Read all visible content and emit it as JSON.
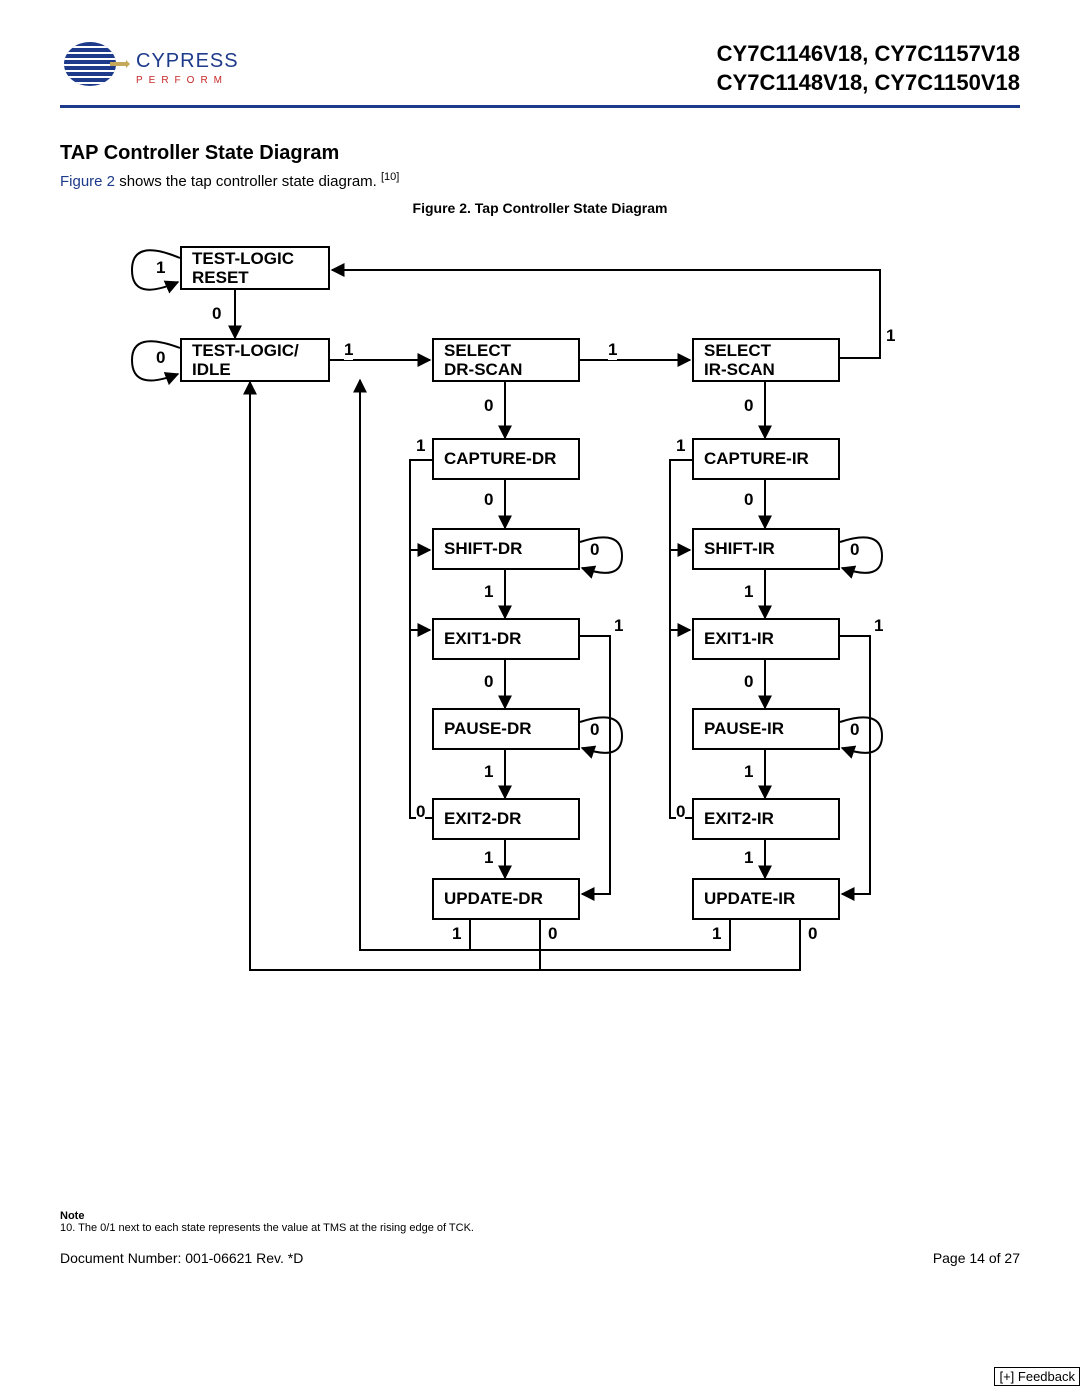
{
  "header": {
    "logo_name": "CYPRESS",
    "logo_tagline": "PERFORM",
    "parts_line1": "CY7C1146V18, CY7C1157V18",
    "parts_line2": "CY7C1148V18, CY7C1150V18"
  },
  "section_title": "TAP Controller State Diagram",
  "intro_prefix": "Figure 2",
  "intro_rest": " shows the tap controller state diagram. ",
  "intro_foot": "[10]",
  "figure_caption": "Figure 2. Tap Controller State Diagram",
  "states": {
    "tlr": "TEST-LOGIC\nRESET",
    "rti": "TEST-LOGIC/\nIDLE",
    "sel_dr": "SELECT\nDR-SCAN",
    "sel_ir": "SELECT\nIR-SCAN",
    "cap_dr": "CAPTURE-DR",
    "cap_ir": "CAPTURE-IR",
    "shift_dr": "SHIFT-DR",
    "shift_ir": "SHIFT-IR",
    "exit1_dr": "EXIT1-DR",
    "exit1_ir": "EXIT1-IR",
    "pause_dr": "PAUSE-DR",
    "pause_ir": "PAUSE-IR",
    "exit2_dr": "EXIT2-DR",
    "exit2_ir": "EXIT2-IR",
    "update_dr": "UPDATE-DR",
    "update_ir": "UPDATE-IR"
  },
  "edge_labels": {
    "tlr_self": "1",
    "tlr_to_rti": "0",
    "rti_self": "0",
    "rti_to_seldr": "1",
    "seldr_to_selir": "1",
    "selir_to_tlr": "1",
    "seldr_to_capdr": "0",
    "selir_to_capir": "0",
    "capdr_to_exit1dr": "1",
    "capir_to_exit1ir": "1",
    "capdr_to_shiftdr": "0",
    "capir_to_shiftir": "0",
    "shiftdr_self": "0",
    "shiftir_self": "0",
    "shiftdr_to_exit1dr": "1",
    "shiftir_to_exit1ir": "1",
    "exit1dr_to_updatedr": "1",
    "exit1ir_to_updateir": "1",
    "exit1dr_to_pausedr": "0",
    "exit1ir_to_pauseir": "0",
    "pausedr_self": "0",
    "pauseir_self": "0",
    "pausedr_to_exit2dr": "1",
    "pauseir_to_exit2ir": "1",
    "exit2dr_to_shiftdr": "0",
    "exit2ir_to_shiftir": "0",
    "exit2dr_to_updatedr": "1",
    "exit2ir_to_updateir": "1",
    "updatedr_to_seldr_1": "1",
    "updatedr_to_rti_0": "0",
    "updateir_to_seldr_1": "1",
    "updateir_to_rti_0": "0"
  },
  "note_heading": "Note",
  "note_text": "10. The 0/1 next to each state represents the value at TMS at the rising edge of TCK.",
  "footer": {
    "doc": "Document Number: 001-06621  Rev. *D",
    "page": "Page 14 of 27"
  },
  "feedback": "[+] Feedback"
}
